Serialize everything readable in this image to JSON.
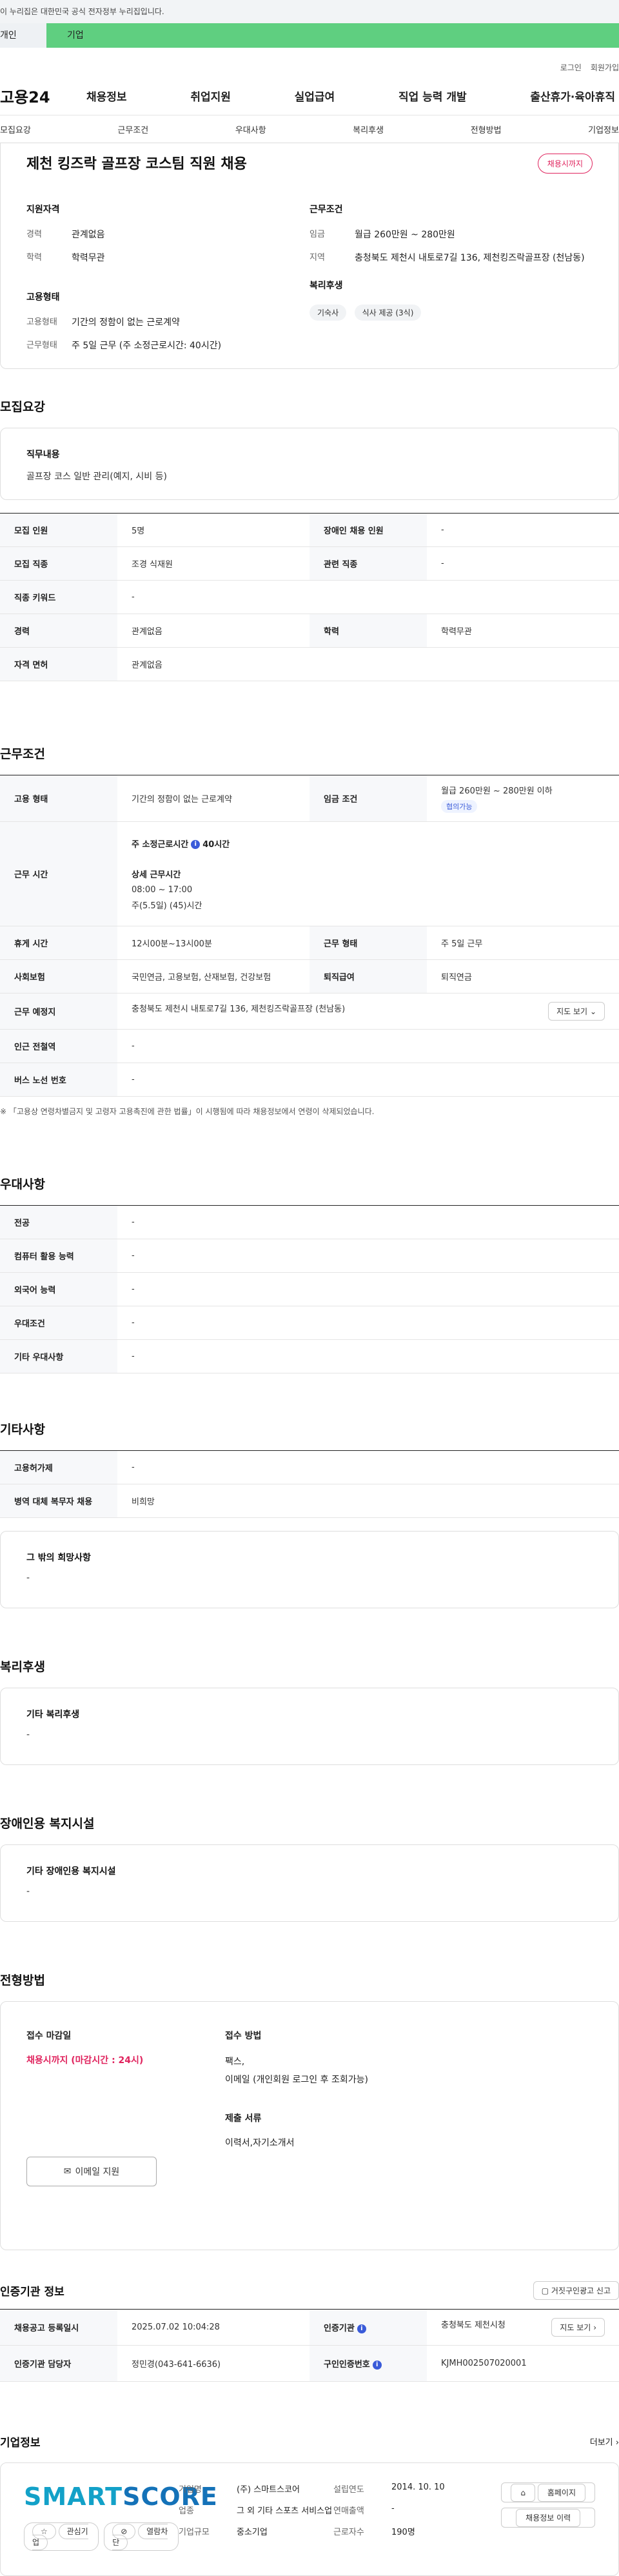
{
  "gov_banner": "이 누리집은 대한민국 공식 전자정부 누리집입니다.",
  "tabs": {
    "individual": "개인",
    "company": "기업"
  },
  "util": {
    "login": "로그인",
    "signup": "회원가입"
  },
  "site": {
    "logo": "고용24"
  },
  "gnb": [
    "채용정보",
    "취업지원",
    "실업급여",
    "직업 능력 개발",
    "출산휴가·육아휴직"
  ],
  "subnav": [
    "모집요강",
    "근무조건",
    "우대사항",
    "복리후생",
    "전형방법",
    "기업정보"
  ],
  "summary": {
    "title": "제천 킹즈락 골프장 코스팀 직원 채용",
    "status": "채용시까지",
    "qual_title": "지원자격",
    "career_label": "경력",
    "career_value": "관계없음",
    "edu_label": "학력",
    "edu_value": "학력무관",
    "emp_title": "고용형태",
    "emptype_label": "고용형태",
    "emptype_value": "기간의 정함이 없는 근로계약",
    "worktype_label": "근무형태",
    "worktype_value": "주 5일 근무 (주 소정근로시간: 40시간)",
    "cond_title": "근무조건",
    "wage_label": "임금",
    "wage_value": "월급 260만원 ~ 280만원",
    "region_label": "지역",
    "region_value": "충청북도 제천시 내토로7길 136, 제천킹즈락골프장 (천남동)",
    "welfare_title": "복리후생",
    "welfare_chips": [
      "기숙사",
      "식사 제공 (3식)"
    ]
  },
  "recruit": {
    "title": "모집요강",
    "duty_title": "직무내용",
    "duty_value": "골프장 코스 일반 관리(예지, 시비 등)",
    "rows": {
      "count_label": "모집 인원",
      "count_value": "5명",
      "disabled_label": "장애인 채용 인원",
      "disabled_value": "-",
      "job_label": "모집 직종",
      "job_value": "조경 식재원",
      "rel_label": "관련 직종",
      "rel_value": "-",
      "kw_label": "직종 키워드",
      "kw_value": "-",
      "career_label": "경력",
      "career_value": "관계없음",
      "edu_label": "학력",
      "edu_value": "학력무관",
      "lic_label": "자격 면허",
      "lic_value": "관계없음"
    }
  },
  "work": {
    "title": "근무조건",
    "emptype_label": "고용 형태",
    "emptype_value": "기간의 정함이 없는 근로계약",
    "wage_label": "임금 조건",
    "wage_value": "월급 260만원 ~ 280만원 이하",
    "wage_pill": "협의가능",
    "time_label": "근무 시간",
    "time_weekly_label": "주 소정근로시간",
    "time_weekly_value": "40시간",
    "time_detail_label": "상세 근무시간",
    "time_detail_hours": "08:00 ~ 17:00",
    "time_detail_week": "주(5.5일) (45)시간",
    "rest_label": "휴게 시간",
    "rest_value": "12시00분~13시00분",
    "form_label": "근무 형태",
    "form_value": "주 5일 근무",
    "ins_label": "사회보험",
    "ins_value": "국민연금, 고용보험, 산재보험, 건강보험",
    "sev_label": "퇴직급여",
    "sev_value": "퇴직연금",
    "place_label": "근무 예정지",
    "place_value": "충청북도 제천시 내토로7길 136, 제천킹즈락골프장 (천남동)",
    "map_btn": "지도 보기",
    "station_label": "인근 전철역",
    "station_value": "-",
    "bus_label": "버스 노선 번호",
    "bus_value": "-",
    "note": "※ 「고용상 연령차별금지 및 고령자 고용촉진에 관한 법률」이 시행됨에 따라 채용정보에서 연령이 삭제되었습니다."
  },
  "pref": {
    "title": "우대사항",
    "rows": [
      {
        "label": "전공",
        "value": "-"
      },
      {
        "label": "컴퓨터 활용 능력",
        "value": "-"
      },
      {
        "label": "외국어 능력",
        "value": "-"
      },
      {
        "label": "우대조건",
        "value": "-"
      },
      {
        "label": "기타 우대사항",
        "value": "-"
      }
    ]
  },
  "etc": {
    "title": "기타사항",
    "rows": [
      {
        "label": "고용허가제",
        "value": "-"
      },
      {
        "label": "병역 대체 복무자 채용",
        "value": "비희망"
      }
    ],
    "box_title": "그 밖의 희망사항",
    "box_value": "-"
  },
  "welfare": {
    "title": "복리후생",
    "box_title": "기타 복리후생",
    "box_value": "-"
  },
  "disability": {
    "title": "장애인용 복지시설",
    "box_title": "기타 장애인용 복지시설",
    "box_value": "-"
  },
  "process": {
    "title": "전형방법",
    "deadline_label": "접수 마감일",
    "deadline_value": "채용시까지 (마감시간 : 24시)",
    "method_label": "접수 방법",
    "method_value1": "팩스,",
    "method_value2": "이메일 (개인회원 로그인 후 조회가능)",
    "docs_label": "제출 서류",
    "docs_value": "이력서,자기소개서",
    "apply_btn": "이메일 지원"
  },
  "cert": {
    "title": "인증기관 정보",
    "report_btn": "거짓구인광고 신고",
    "reg_label": "채용공고 등록일시",
    "reg_value": "2025.07.02 10:04:28",
    "org_label": "인증기관",
    "org_value": "충청북도 제천시청",
    "map_btn": "지도 보기",
    "mgr_label": "인증기관 담당자",
    "mgr_value": "정민경(043-641-6636)",
    "no_label": "구인인증번호",
    "no_value": "KJMH002507020001"
  },
  "company": {
    "title": "기업정보",
    "more": "더보기",
    "brand_a": "SMART",
    "brand_b": "SCORE",
    "fav": "관심기업",
    "block": "열람차단",
    "name_label": "기업명",
    "name_value": "(주) 스마트스코어",
    "found_label": "설립연도",
    "found_value": "2014. 10. 10",
    "ind_label": "업종",
    "ind_value": "그 외 기타 스포츠 서비스업",
    "sales_label": "연매출액",
    "sales_value": "-",
    "size_label": "기업규모",
    "size_value": "중소기업",
    "emp_label": "근로자수",
    "emp_value": "190명",
    "homepage_btn": "홈페이지",
    "history_btn": "채용정보 이력"
  },
  "colors": {
    "accent_green": "#5fcf80",
    "status_red": "#e0245e",
    "brand_blue": "#13a1c8"
  }
}
